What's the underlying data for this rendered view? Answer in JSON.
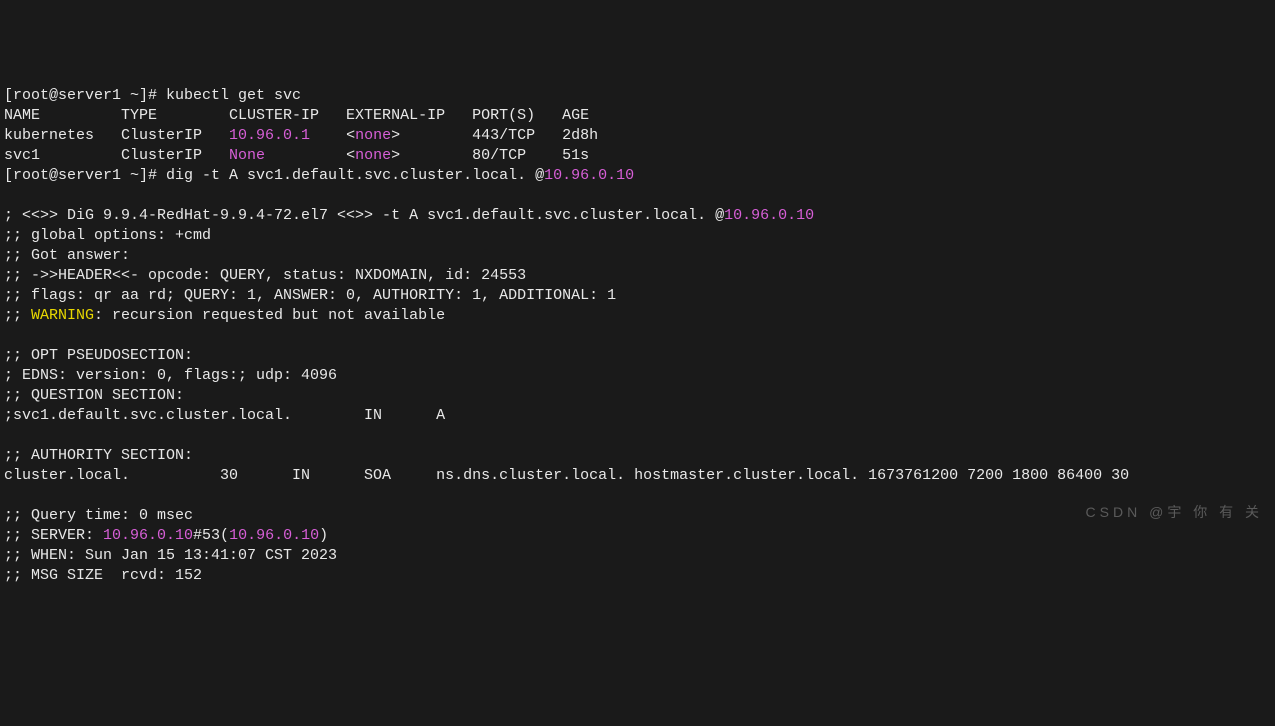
{
  "prompt1": "[root@server1 ~]# ",
  "cmd1": "kubectl get svc",
  "table": {
    "header": "NAME         TYPE        CLUSTER-IP   EXTERNAL-IP   PORT(S)   AGE",
    "row1a": "kubernetes   ClusterIP   ",
    "row1ip": "10.96.0.1",
    "row1b": "    <",
    "row1none": "none",
    "row1c": ">        443/TCP   2d8h",
    "row2a": "svc1         ClusterIP   ",
    "row2none1": "None",
    "row2b": "         <",
    "row2none2": "none",
    "row2c": ">        80/TCP    51s"
  },
  "prompt2": "[root@server1 ~]# ",
  "cmd2a": "dig -t A svc1.default.svc.cluster.local. @",
  "cmd2ip": "10.96.0.10",
  "dig": {
    "banner_a": "; <<>> DiG 9.9.4-RedHat-9.9.4-72.el7 <<>> -t A svc1.default.svc.cluster.local. @",
    "banner_ip": "10.96.0.10",
    "global_opts": ";; global options: +cmd",
    "got_answer": ";; Got answer:",
    "header": ";; ->>HEADER<<- opcode: QUERY, status: NXDOMAIN, id: 24553",
    "flags": ";; flags: qr aa rd; QUERY: 1, ANSWER: 0, AUTHORITY: 1, ADDITIONAL: 1",
    "warn_prefix": ";; ",
    "warn_word": "WARNING",
    "warn_rest": ": recursion requested but not available",
    "opt_hdr": ";; OPT PSEUDOSECTION:",
    "edns": "; EDNS: version: 0, flags:; udp: 4096",
    "q_hdr": ";; QUESTION SECTION:",
    "q_line": ";svc1.default.svc.cluster.local.        IN      A",
    "auth_hdr": ";; AUTHORITY SECTION:",
    "auth_line": "cluster.local.          30      IN      SOA     ns.dns.cluster.local. hostmaster.cluster.local. 1673761200 7200 1800 86400 30",
    "qtime": ";; Query time: 0 msec",
    "server_a": ";; SERVER: ",
    "server_ip1": "10.96.0.10",
    "server_mid": "#53(",
    "server_ip2": "10.96.0.10",
    "server_end": ")",
    "when": ";; WHEN: Sun Jan 15 13:41:07 CST 2023",
    "msg_size": ";; MSG SIZE  rcvd: 152"
  },
  "watermark": "CSDN @宇 你 有 关"
}
